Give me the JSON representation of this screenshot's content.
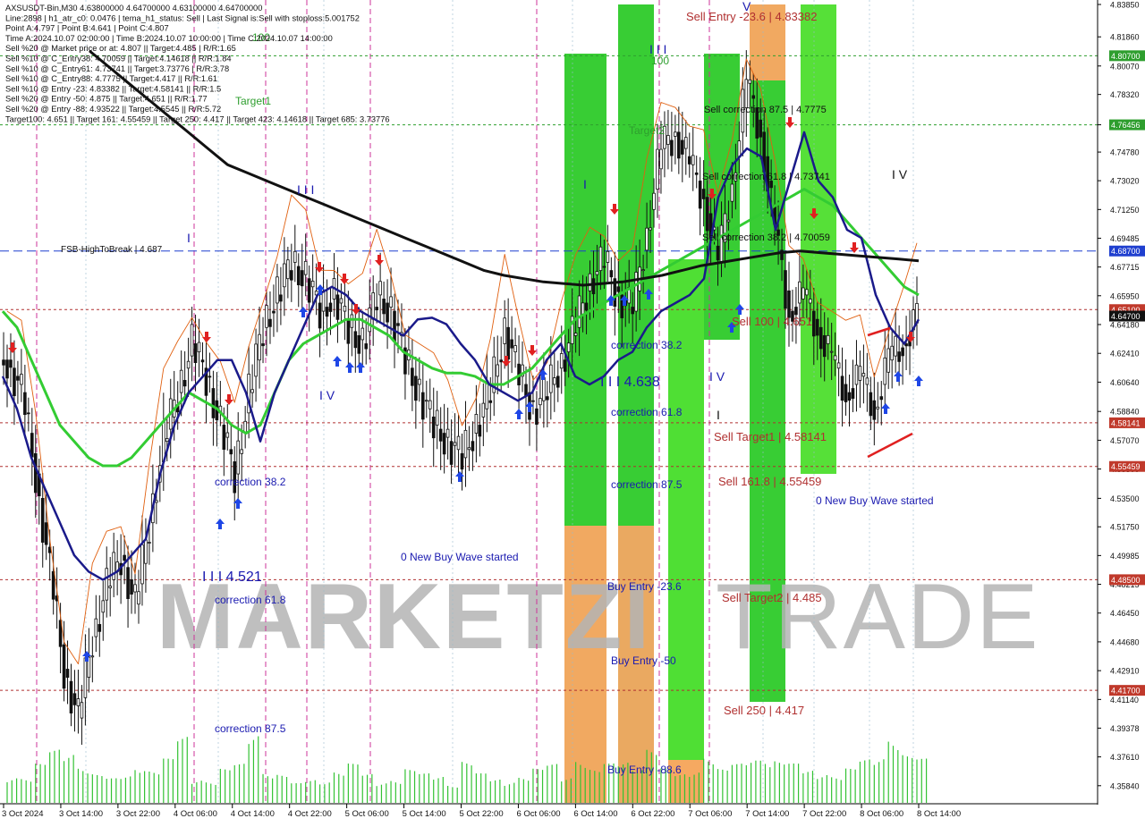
{
  "header": {
    "lines": [
      "AXSUSDT-Bin,M30  4.63800000 4.64700000 4.63100000 4.64700000",
      "Line:2898 | h1_atr_c0: 0.0476 | tema_h1_status: Sell | Last Signal is:Sell with stoploss:5.001752",
      "Point A:4.797 | Point B:4.641 | Point C:4.807",
      "Time A:2024.10.07 02:00:00 | Time B:2024.10.07 10:00:00 | Time C:2024.10.07 14:00:00",
      "Sell %20 @ Market price or at: 4.807 || Target:4.485 | R/R:1.65",
      "Sell %10 @ C_Entry38: 4.70059 || Target:4.14618 || R/R:1.84",
      "Sell %10 @ C_Entry61: 4.73741 || Target:3.73776 | R/R:3.78",
      "Sell %10 @ C_Entry88: 4.7775 || Target:4.417 || R/R:1.61",
      "Sell %10 @ Entry -23: 4.83382 || Target:4.58141 || R/R:1.5",
      "Sell %20 @ Entry -50: 4.875 || Target:4.651 || R/R:1.77",
      "Sell %20 @ Entry -88: 4.93522 || Target:4.5545 || R/R:5.72",
      "Target100: 4.651 || Target 161: 4.55459 || Target 250: 4.417 || Target 423: 4.14618 || Target 685: 3.73776"
    ]
  },
  "watermark": {
    "bold": "MARKETZI",
    "light": "TRADE"
  },
  "y_ticks": [
    "4.83850",
    "4.81860",
    "4.80070",
    "4.78320",
    "4.76456",
    "4.74780",
    "4.73020",
    "4.71250",
    "4.69485",
    "4.67715",
    "4.65950",
    "4.64180",
    "4.62410",
    "4.60640",
    "4.58840",
    "4.57070",
    "4.55300",
    "4.53500",
    "4.51750",
    "4.49985",
    "4.48215",
    "4.46450",
    "4.44680",
    "4.42910",
    "4.41140",
    "4.39378",
    "4.37610",
    "4.35840"
  ],
  "price_tags": [
    {
      "text": "4.80700",
      "price": 4.807,
      "color": "#2e9e2e"
    },
    {
      "text": "4.76456",
      "price": 4.76456,
      "color": "#2e9e2e"
    },
    {
      "text": "4.68700",
      "price": 4.687,
      "color": "#1f3fcf"
    },
    {
      "text": "4.65100",
      "price": 4.651,
      "color": "#c0392b"
    },
    {
      "text": "4.64700",
      "price": 4.647,
      "color": "#111111"
    },
    {
      "text": "4.58141",
      "price": 4.58141,
      "color": "#c0392b"
    },
    {
      "text": "4.55459",
      "price": 4.55459,
      "color": "#c0392b"
    },
    {
      "text": "4.48500",
      "price": 4.485,
      "color": "#c0392b"
    },
    {
      "text": "4.41700",
      "price": 4.417,
      "color": "#c0392b"
    }
  ],
  "x_ticks": [
    "3 Oct 2024",
    "3 Oct 14:00",
    "3 Oct 22:00",
    "4 Oct 06:00",
    "4 Oct 14:00",
    "4 Oct 22:00",
    "5 Oct 06:00",
    "5 Oct 14:00",
    "5 Oct 22:00",
    "6 Oct 06:00",
    "6 Oct 14:00",
    "6 Oct 22:00",
    "7 Oct 06:00",
    "7 Oct 14:00",
    "7 Oct 22:00",
    "8 Oct 06:00",
    "8 Oct 14:00"
  ],
  "annotations": {
    "fsb": "FSB-HighToBreak | 4.687",
    "sell_entry_236": "Sell Entry -23.6 | 4.83382",
    "sell_corr_875": "Sell correction 87.5 | 4.7775",
    "sell_corr_618": "Sell correction 61.8 | 4.73741",
    "sell_corr_382": "Sell correction 38.2 | 4.70059",
    "sell_100": "Sell 100 | 4.651",
    "sell_target1": "Sell Target1 | 4.58141",
    "sell_161": "Sell 161.8 | 4.55459",
    "sell_target2": "Sell Target2 | 4.485",
    "sell_250": "Sell  250 | 4.417",
    "buy_entry_236": "Buy Entry -23.6",
    "buy_entry_50": "Buy Entry -50",
    "buy_entry_886": "Buy Entry -88.6",
    "new_buy_wave_1": "0 New Buy Wave started",
    "new_buy_wave_2": "0 New Buy Wave started",
    "wave_4521": "I I I 4.521",
    "wave_4638": "I I I 4.638",
    "corr_382_a": "correction 38.2",
    "corr_618_a": "correction 61.8",
    "corr_875_a": "correction 87.5",
    "corr_382_b": "correction 38.2",
    "corr_618_b": "correction 61.8",
    "corr_875_b": "correction 87.5",
    "target1": "Target1",
    "target2": "Target2",
    "num_100a": "100",
    "num_100b": "100",
    "wave_i_1": "I",
    "wave_iii_1": "I I I",
    "wave_iv_1": "I V",
    "wave_i_2": "I",
    "wave_iv_2": "I V",
    "wave_iii_2": "I I I",
    "wave_i_3": "I",
    "wave_v": "V",
    "wave_iv_3": "I V"
  },
  "chart_data": {
    "type": "candlestick",
    "symbol": "AXSUSDT-Bin",
    "timeframe": "M30",
    "ylim": [
      4.3495,
      4.8385
    ],
    "levels": [
      {
        "name": "FSB-HighToBreak",
        "price": 4.687,
        "color": "#1f3fcf",
        "style": "dashed"
      },
      {
        "name": "Sell 100",
        "price": 4.651,
        "color": "#b03030",
        "style": "dashed"
      },
      {
        "name": "Sell Target1",
        "price": 4.58141,
        "color": "#b03030",
        "style": "dashed"
      },
      {
        "name": "Sell 161.8",
        "price": 4.55459,
        "color": "#b03030",
        "style": "dashed"
      },
      {
        "name": "Sell Target2",
        "price": 4.485,
        "color": "#b03030",
        "style": "dashed"
      },
      {
        "name": "Sell 250",
        "price": 4.417,
        "color": "#b03030",
        "style": "dashed"
      },
      {
        "name": "4.80700",
        "price": 4.807,
        "color": "#2e9e2e",
        "style": "dashed"
      },
      {
        "name": "4.76456",
        "price": 4.76456,
        "color": "#2e9e2e",
        "style": "dashed"
      }
    ],
    "navy_ma": [
      4.61,
      4.59,
      4.56,
      4.54,
      4.52,
      4.5,
      4.49,
      4.485,
      4.49,
      4.5,
      4.51,
      4.55,
      4.58,
      4.6,
      4.61,
      4.62,
      4.62,
      4.6,
      4.57,
      4.6,
      4.62,
      4.64,
      4.66,
      4.665,
      4.66,
      4.65,
      4.645,
      4.64,
      4.635,
      4.645,
      4.646,
      4.642,
      4.63,
      4.62,
      4.605,
      4.6,
      4.595,
      4.6,
      4.62,
      4.63,
      4.61,
      4.605,
      4.61,
      4.62,
      4.625,
      4.64,
      4.65,
      4.655,
      4.66,
      4.67,
      4.72,
      4.74,
      4.75,
      4.745,
      4.7,
      4.73,
      4.76,
      4.73,
      4.72,
      4.7,
      4.695,
      4.66,
      4.64,
      4.63,
      4.645
    ],
    "green_ma": [
      4.65,
      4.64,
      4.62,
      4.6,
      4.58,
      4.57,
      4.56,
      4.555,
      4.555,
      4.56,
      4.57,
      4.58,
      4.59,
      4.6,
      4.595,
      4.59,
      4.58,
      4.575,
      4.58,
      4.6,
      4.62,
      4.63,
      4.635,
      4.64,
      4.645,
      4.645,
      4.64,
      4.635,
      4.625,
      4.62,
      4.615,
      4.612,
      4.612,
      4.61,
      4.605,
      4.605,
      4.61,
      4.615,
      4.625,
      4.635,
      4.645,
      4.65,
      4.655,
      4.66,
      4.665,
      4.67,
      4.675,
      4.68,
      4.685,
      4.69,
      4.695,
      4.7,
      4.705,
      4.71,
      4.715,
      4.72,
      4.725,
      4.72,
      4.715,
      4.705,
      4.695,
      4.685,
      4.675,
      4.665,
      4.66
    ],
    "black_ma": [
      4.81,
      4.8,
      4.79,
      4.78,
      4.77,
      4.76,
      4.75,
      4.74,
      4.735,
      4.73,
      4.725,
      4.72,
      4.715,
      4.71,
      4.705,
      4.7,
      4.695,
      4.69,
      4.685,
      4.68,
      4.675,
      4.672,
      4.67,
      4.668,
      4.667,
      4.666,
      4.667,
      4.668,
      4.67,
      4.672,
      4.675,
      4.678,
      4.68,
      4.682,
      4.684,
      4.686,
      4.687,
      4.686,
      4.685,
      4.684,
      4.683,
      4.682,
      4.681
    ],
    "close": [
      4.62,
      4.6,
      4.55,
      4.49,
      4.43,
      4.4,
      4.45,
      4.48,
      4.5,
      4.47,
      4.52,
      4.57,
      4.6,
      4.63,
      4.61,
      4.58,
      4.55,
      4.6,
      4.64,
      4.66,
      4.68,
      4.67,
      4.65,
      4.66,
      4.64,
      4.63,
      4.66,
      4.65,
      4.62,
      4.6,
      4.58,
      4.57,
      4.56,
      4.58,
      4.6,
      4.64,
      4.61,
      4.59,
      4.6,
      4.62,
      4.64,
      4.67,
      4.68,
      4.66,
      4.65,
      4.7,
      4.75,
      4.76,
      4.74,
      4.72,
      4.68,
      4.73,
      4.79,
      4.76,
      4.7,
      4.65,
      4.66,
      4.64,
      4.62,
      4.6,
      4.61,
      4.59,
      4.62,
      4.63,
      4.647
    ],
    "volume": [
      0.35,
      0.28,
      0.4,
      0.55,
      0.6,
      0.45,
      0.3,
      0.25,
      0.3,
      0.5,
      0.35,
      0.45,
      0.7,
      0.3,
      0.25,
      0.35,
      0.4,
      0.8,
      0.4,
      0.3,
      0.2,
      0.25,
      0.3,
      0.35,
      0.4,
      0.3,
      0.25,
      0.28,
      0.35,
      0.3,
      0.3,
      0.25,
      0.45,
      0.3,
      0.25,
      0.28,
      0.3,
      0.35,
      0.4,
      0.3,
      0.55,
      0.35,
      0.4,
      0.45,
      0.5,
      0.6,
      0.35,
      0.3,
      0.4,
      0.55,
      0.35,
      0.4,
      0.5,
      0.6,
      0.45,
      0.4,
      0.35,
      0.4,
      0.3,
      0.35,
      0.45,
      0.55,
      0.8,
      0.5,
      0.45
    ]
  }
}
